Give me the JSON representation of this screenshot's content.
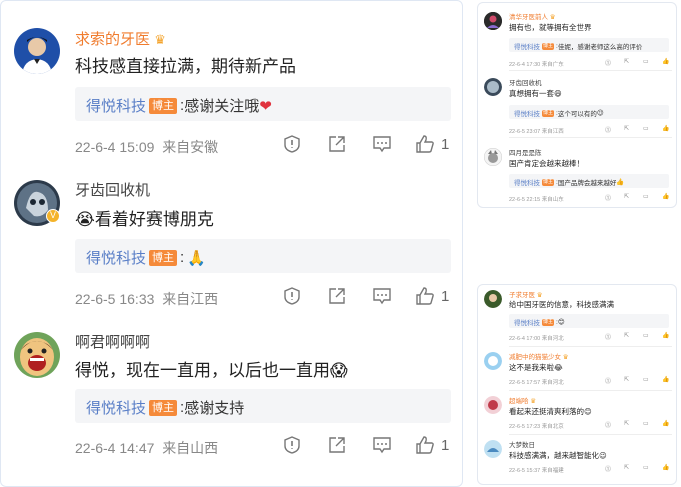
{
  "main": {
    "comments": [
      {
        "username": "求索的牙医",
        "username_color": "#f07c2e",
        "has_crown": true,
        "text": "科技感直接拉满，期待新产品",
        "reply_author": "得悦科技",
        "reply_badge": "博主",
        "reply_text": "感谢关注哦",
        "reply_emoji": "❤",
        "time": "22-6-4 15:09",
        "source": "来自安徽",
        "likes": "1"
      },
      {
        "username": "牙齿回收机",
        "username_color": "#444444",
        "text_emoji": "😭",
        "text": "看着好赛博朋克",
        "reply_author": "得悦科技",
        "reply_badge": "博主",
        "reply_emoji": "🙏",
        "time": "22-6-5 16:33",
        "source": "来自江西",
        "likes": "1"
      },
      {
        "username": "啊君啊啊啊",
        "username_color": "#444444",
        "text": "得悦，现在一直用，以后也一直用",
        "text_emoji": "😱",
        "reply_author": "得悦科技",
        "reply_badge": "博主",
        "reply_text": "感谢支持",
        "time": "22-6-4 14:47",
        "source": "来自山西",
        "likes": "1"
      }
    ]
  },
  "top_right": {
    "comments": [
      {
        "username": "清华牙医前人",
        "username_color": "#f07c2e",
        "has_crown": true,
        "text": "拥有也，就等拥有全世界",
        "reply_author": "得悦科技",
        "reply_badge": "博主",
        "reply_text": "佳妮，感谢老师这么高的评价",
        "time": "22-6-4 17:30",
        "source": "来自广东"
      },
      {
        "username": "牙齿回收机",
        "username_color": "#444444",
        "text": "真想拥有一套",
        "text_emoji": "😄",
        "reply_author": "得悦科技",
        "reply_badge": "博主",
        "reply_text": "这个可以有的",
        "reply_emoji": "😉",
        "time": "22-6-5 23:07",
        "source": "来自江西"
      },
      {
        "username": "四月是是陈",
        "username_color": "#444444",
        "text": "国产肯定会越来越棒！",
        "reply_author": "得悦科技",
        "reply_badge": "博主",
        "reply_text": "国产品牌会越来越好",
        "reply_emoji": "👍",
        "time": "22-6-5 22:15",
        "source": "来自山东"
      }
    ]
  },
  "bottom_right": {
    "comments": [
      {
        "username": "子求牙医",
        "username_color": "#f07c2e",
        "has_crown": true,
        "text": "给中国牙医的信意，科技感满满",
        "reply_author": "得悦科技",
        "reply_badge": "博主",
        "reply_emoji": "😊",
        "time": "22-6-4 17:00",
        "source": "来自河北"
      },
      {
        "username": "减肥中的猫猫少女",
        "username_color": "#f07c2e",
        "has_crown": true,
        "text": "这不是我来啦",
        "text_emoji": "😂",
        "time": "22-6-5 17:57",
        "source": "来自河北"
      },
      {
        "username": "超端哈",
        "username_color": "#f07c2e",
        "has_crown": true,
        "text": "看起来还挺清爽利落的",
        "text_emoji": "😊",
        "time": "22-6-5 17:23",
        "source": "来自北京"
      },
      {
        "username": "大梦数日",
        "username_color": "#444444",
        "text": "科技感满满，越来越智能化",
        "text_emoji": "😉",
        "time": "22-6-5 15:37",
        "source": "来自福建"
      }
    ]
  }
}
